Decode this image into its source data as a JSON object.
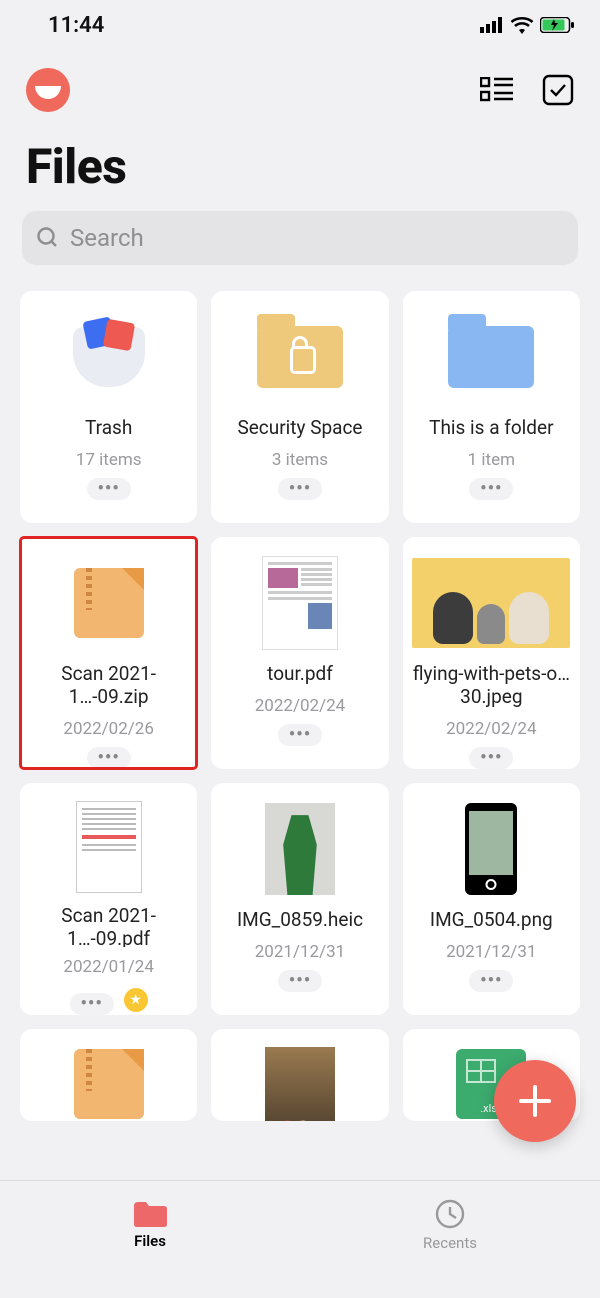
{
  "status": {
    "time": "11:44"
  },
  "header": {
    "title": "Files"
  },
  "search": {
    "placeholder": "Search"
  },
  "items": [
    {
      "title": "Trash",
      "sub": "17 items",
      "kind": "trash",
      "starred": false,
      "selected": false
    },
    {
      "title": "Security Space",
      "sub": "3 items",
      "kind": "locked",
      "starred": false,
      "selected": false
    },
    {
      "title": "This is a folder",
      "sub": "1 item",
      "kind": "folder",
      "starred": false,
      "selected": false
    },
    {
      "title": "Scan 2021-1…-09.zip",
      "sub": "2022/02/26",
      "kind": "zip",
      "starred": false,
      "selected": true
    },
    {
      "title": "tour.pdf",
      "sub": "2022/02/24",
      "kind": "pdf",
      "starred": false,
      "selected": false
    },
    {
      "title": "flying-with-pets-o…30.jpeg",
      "sub": "2022/02/24",
      "kind": "pets",
      "starred": false,
      "selected": false
    },
    {
      "title": "Scan 2021-1…-09.pdf",
      "sub": "2022/01/24",
      "kind": "scan",
      "starred": true,
      "selected": false
    },
    {
      "title": "IMG_0859.heic",
      "sub": "2021/12/31",
      "kind": "plant",
      "starred": false,
      "selected": false
    },
    {
      "title": "IMG_0504.png",
      "sub": "2021/12/31",
      "kind": "phone",
      "starred": false,
      "selected": false
    },
    {
      "title": "",
      "sub": "",
      "kind": "zip",
      "starred": false,
      "selected": false,
      "partial": true
    },
    {
      "title": "",
      "sub": "",
      "kind": "video",
      "starred": false,
      "selected": false,
      "partial": true
    },
    {
      "title": "",
      "sub": "",
      "kind": "xlsx",
      "starred": false,
      "selected": false,
      "partial": true
    }
  ],
  "xlsx_label": ".xlsx",
  "nav": {
    "files": "Files",
    "recents": "Recents"
  }
}
